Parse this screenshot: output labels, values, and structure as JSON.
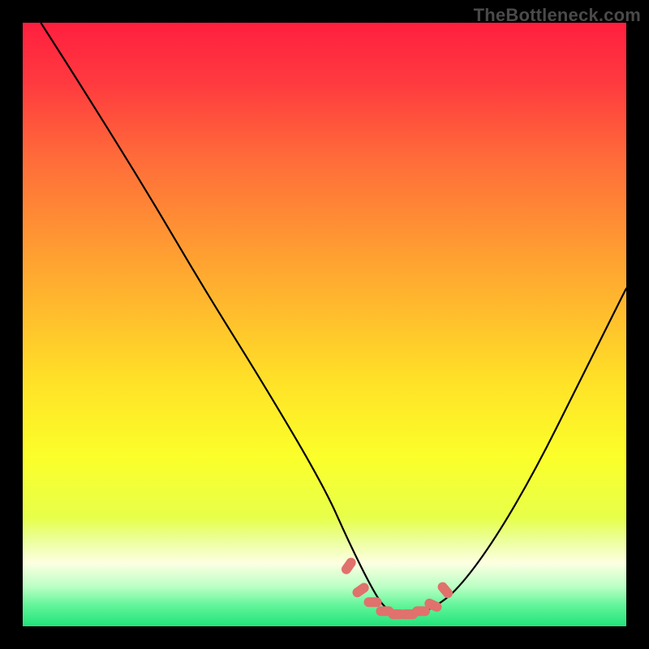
{
  "watermark": "TheBottleneck.com",
  "colors": {
    "background": "#000000",
    "watermark_text": "#4a4a4a",
    "curve": "#000000",
    "marker": "#e0716c",
    "gradient_stops": [
      {
        "offset": 0.0,
        "color": "#ff1f3f"
      },
      {
        "offset": 0.1,
        "color": "#ff3a3f"
      },
      {
        "offset": 0.22,
        "color": "#ff6a3a"
      },
      {
        "offset": 0.35,
        "color": "#ff9433"
      },
      {
        "offset": 0.48,
        "color": "#ffbd2d"
      },
      {
        "offset": 0.6,
        "color": "#ffe327"
      },
      {
        "offset": 0.72,
        "color": "#fbff2a"
      },
      {
        "offset": 0.82,
        "color": "#e7ff4a"
      },
      {
        "offset": 0.86,
        "color": "#ecffa0"
      },
      {
        "offset": 0.895,
        "color": "#fdffe2"
      },
      {
        "offset": 0.935,
        "color": "#b9ffc4"
      },
      {
        "offset": 0.965,
        "color": "#63f59a"
      },
      {
        "offset": 1.0,
        "color": "#20e37a"
      }
    ]
  },
  "chart_data": {
    "type": "line",
    "title": "",
    "xlabel": "",
    "ylabel": "",
    "xlim": [
      0,
      100
    ],
    "ylim": [
      0,
      100
    ],
    "series": [
      {
        "name": "bottleneck-curve",
        "x": [
          3,
          10,
          20,
          30,
          40,
          50,
          54,
          58,
          60,
          62,
          65,
          68,
          72,
          78,
          85,
          92,
          100
        ],
        "y": [
          100,
          89,
          73,
          56,
          40,
          23,
          14,
          6,
          3,
          2,
          2,
          3,
          6,
          14,
          26,
          40,
          56
        ]
      }
    ],
    "markers": {
      "name": "highlight-band",
      "x": [
        54,
        56,
        58,
        60,
        62,
        64,
        66,
        68,
        70
      ],
      "y": [
        10,
        6,
        4,
        2.5,
        2,
        2,
        2.5,
        3.5,
        6
      ]
    }
  }
}
